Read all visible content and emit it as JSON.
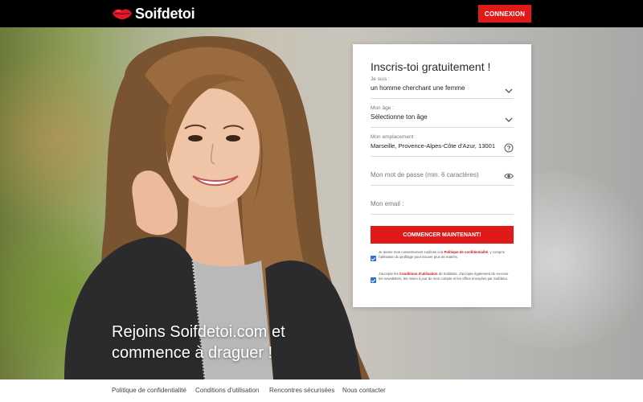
{
  "header": {
    "brand": "Soifdetoi",
    "login_label": "CONNEXION",
    "accent": "#e01919"
  },
  "hero": {
    "headline_line1": "Rejoins Soifdetoi.com et",
    "headline_line2": "commence à draguer !"
  },
  "form": {
    "title": "Inscris-toi gratuitement !",
    "fields": {
      "seeking": {
        "label": "Je suis :",
        "value": "un homme cherchant une femme",
        "icon": "chevron-down-icon"
      },
      "age": {
        "label": "Mon âge :",
        "value": "Sélectionne ton âge",
        "icon": "chevron-down-icon"
      },
      "location": {
        "label": "Mon emplacement :",
        "value": "Marseille, Provence-Alpes-Côte d'Azur, 13001",
        "icon": "help-icon"
      },
      "password": {
        "placeholder": "Mon mot de passe (min. 6 caractères)",
        "icon": "eye-icon"
      },
      "email": {
        "placeholder": "Mon email :"
      }
    },
    "submit_label": "COMMENCER MAINTENANT!",
    "consent1": {
      "checked": true,
      "pre": "Je donne mon consentement explicite à la",
      "link": "Politique de confidentialité",
      "post": ", y compris l'utilisation du profilage pour trouver plus de matchs."
    },
    "consent2": {
      "checked": true,
      "pre": "J'accepte les",
      "link": "Conditions d'utilisation",
      "post": "de Soifdetoi. J'accepte également de recevoir les newsletters, les mises à jour de mon compte et les offres envoyées par Soifdetoi."
    }
  },
  "footer": {
    "links": [
      "Politique de confidentialité",
      "Conditions d'utilisation",
      "Rencontres sécurisées",
      "Nous contacter"
    ]
  }
}
